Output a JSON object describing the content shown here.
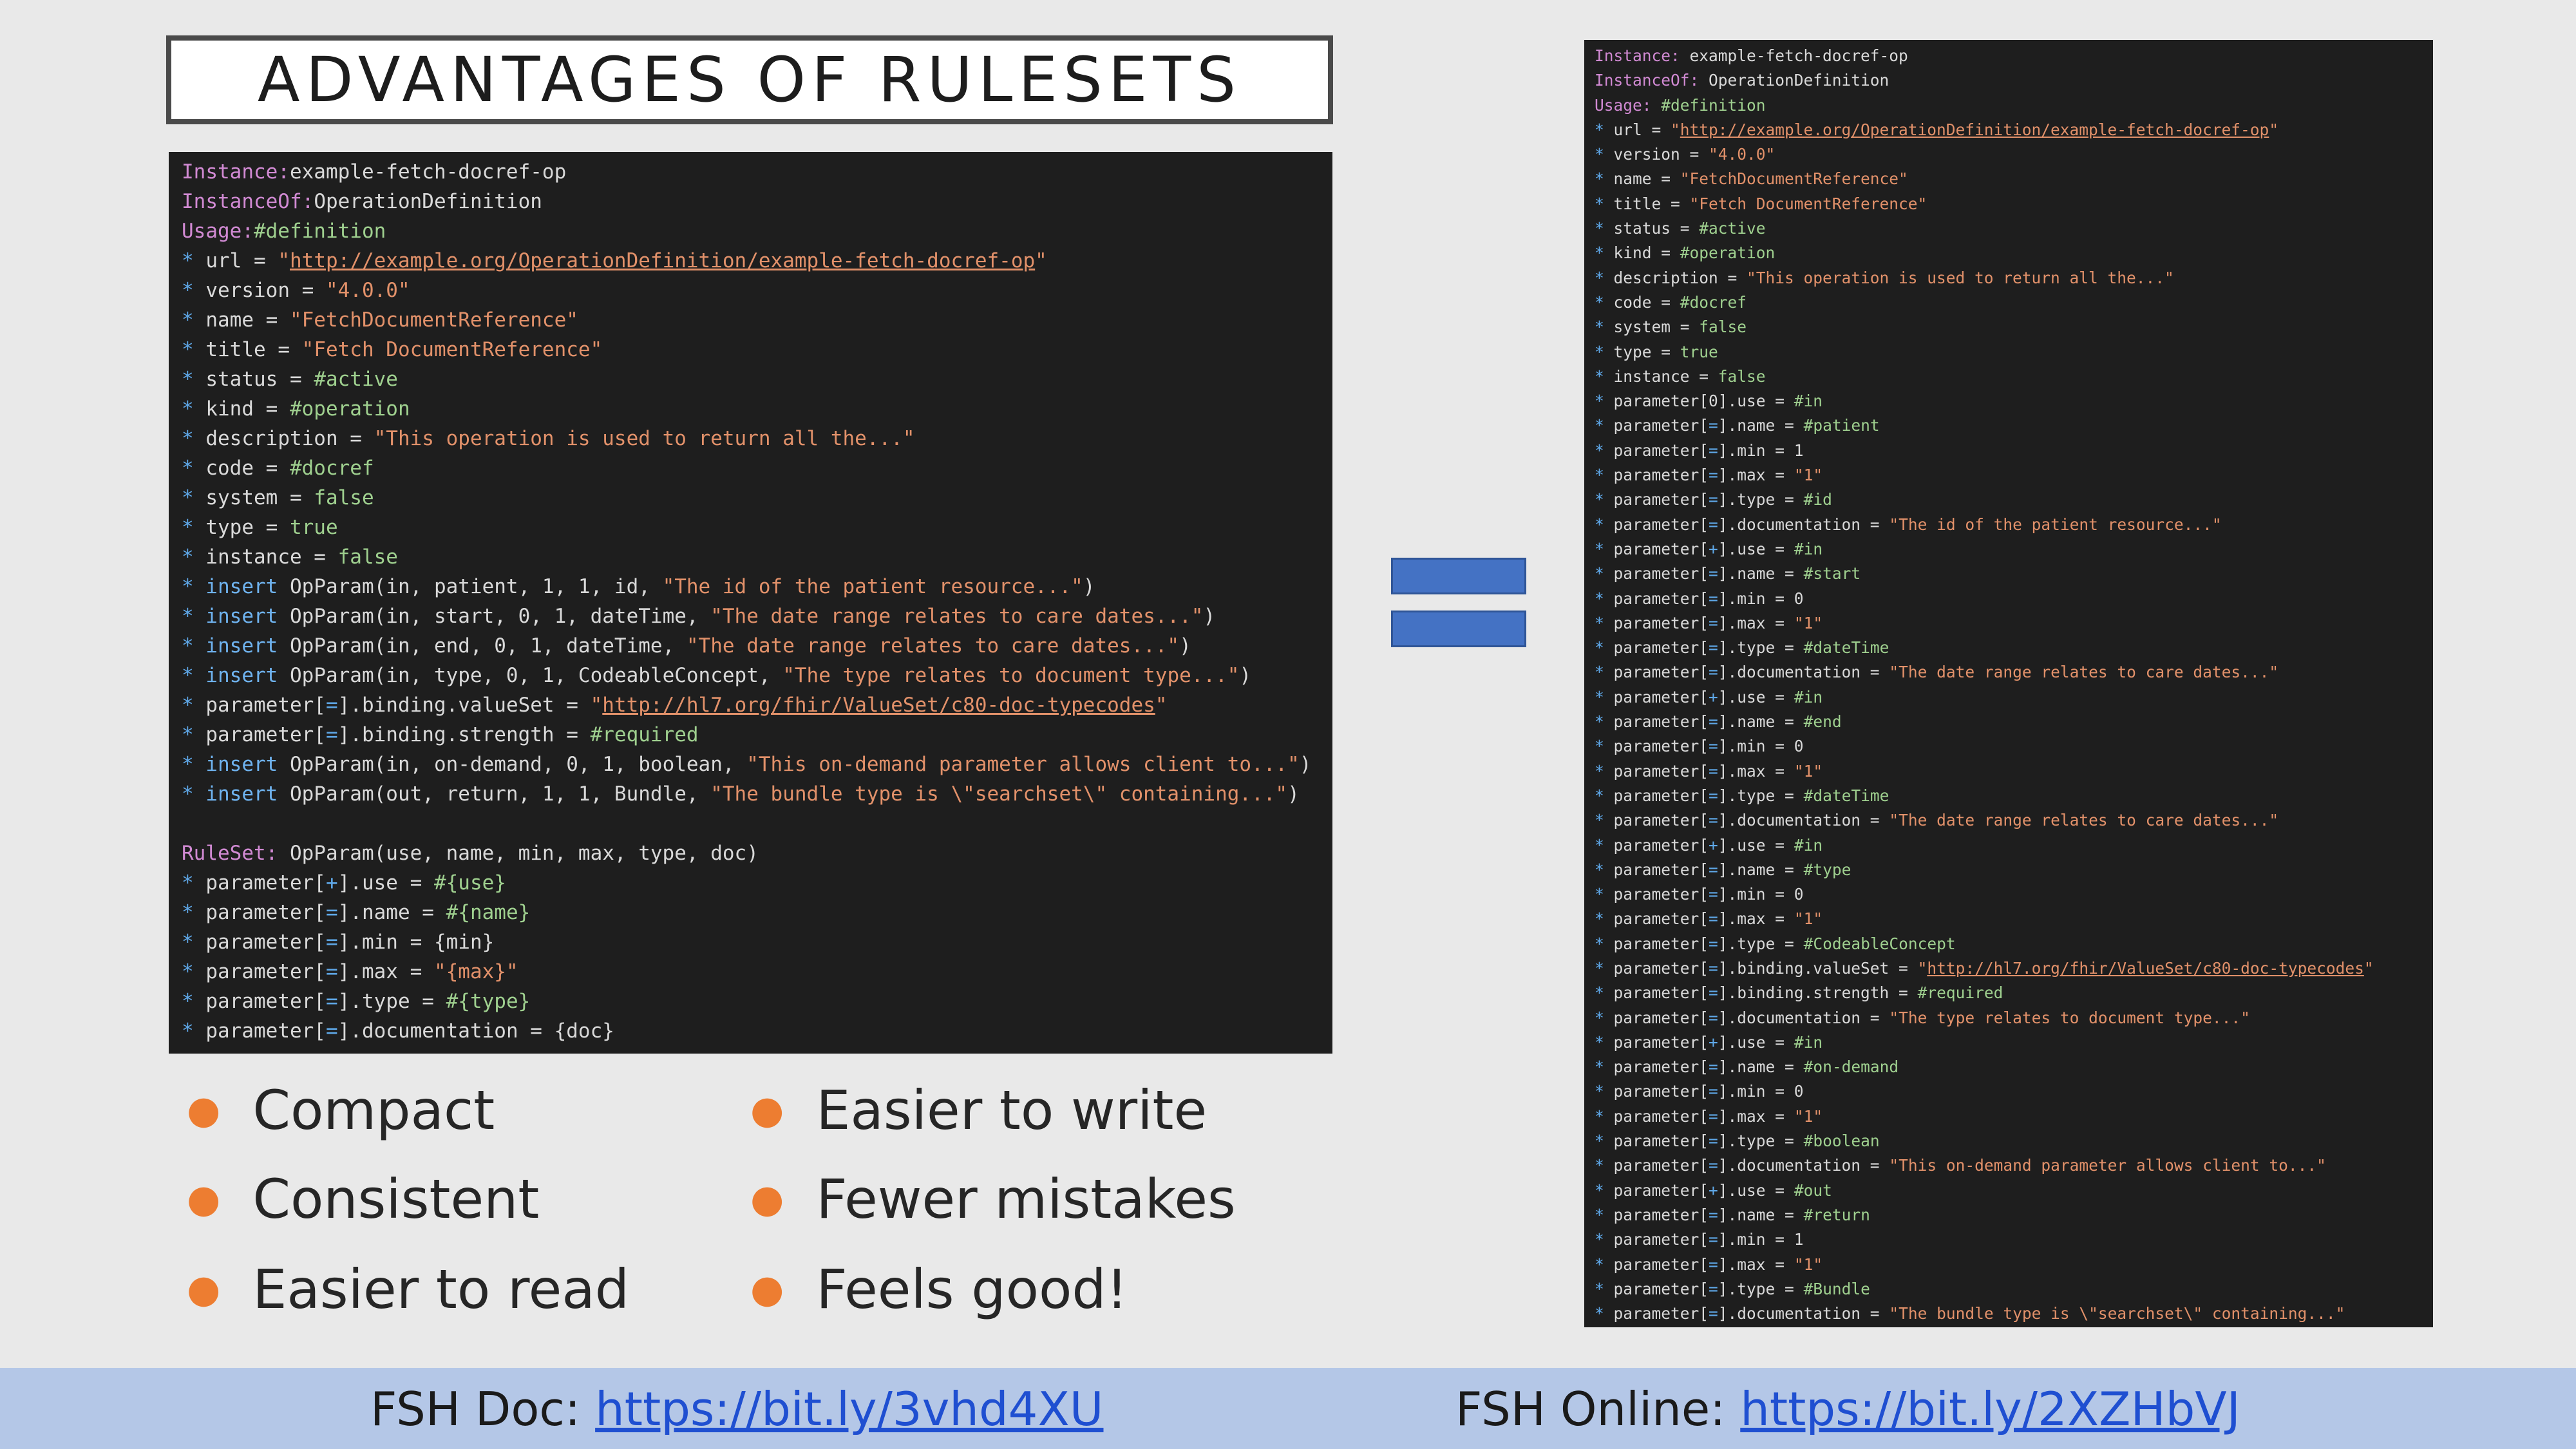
{
  "title": "ADVANTAGES OF RULESETS",
  "code_left": [
    [
      [
        "kw",
        "Instance:"
      ],
      [
        "",
        "example-fetch-docref-op"
      ]
    ],
    [
      [
        "kw",
        "InstanceOf:"
      ],
      [
        "",
        "OperationDefinition"
      ]
    ],
    [
      [
        "kw",
        "Usage:"
      ],
      [
        "lit",
        "#definition"
      ]
    ],
    [
      [
        "star",
        "*"
      ],
      [
        "",
        " url = "
      ],
      [
        "str",
        "\""
      ],
      [
        "str url",
        "http://example.org/OperationDefinition/example-fetch-docref-op"
      ],
      [
        "str",
        "\""
      ]
    ],
    [
      [
        "star",
        "*"
      ],
      [
        "",
        " version = "
      ],
      [
        "str",
        "\"4.0.0\""
      ]
    ],
    [
      [
        "star",
        "*"
      ],
      [
        "",
        " name = "
      ],
      [
        "str",
        "\"FetchDocumentReference\""
      ]
    ],
    [
      [
        "star",
        "*"
      ],
      [
        "",
        " title = "
      ],
      [
        "str",
        "\"Fetch DocumentReference\""
      ]
    ],
    [
      [
        "star",
        "*"
      ],
      [
        "",
        " status = "
      ],
      [
        "lit",
        "#active"
      ]
    ],
    [
      [
        "star",
        "*"
      ],
      [
        "",
        " kind = "
      ],
      [
        "lit",
        "#operation"
      ]
    ],
    [
      [
        "star",
        "*"
      ],
      [
        "",
        " description = "
      ],
      [
        "str",
        "\"This operation is used to return all the...\""
      ]
    ],
    [
      [
        "star",
        "*"
      ],
      [
        "",
        " code = "
      ],
      [
        "lit",
        "#docref"
      ]
    ],
    [
      [
        "star",
        "*"
      ],
      [
        "",
        " system = "
      ],
      [
        "lit",
        "false"
      ]
    ],
    [
      [
        "star",
        "*"
      ],
      [
        "",
        " type = "
      ],
      [
        "lit",
        "true"
      ]
    ],
    [
      [
        "star",
        "*"
      ],
      [
        "",
        " instance = "
      ],
      [
        "lit",
        "false"
      ]
    ],
    [
      [
        "star",
        "*"
      ],
      [
        "ins",
        " insert"
      ],
      [
        "",
        " OpParam(in, patient, 1, 1, id, "
      ],
      [
        "str",
        "\"The id of the patient resource...\""
      ],
      [
        "",
        ")"
      ]
    ],
    [
      [
        "star",
        "*"
      ],
      [
        "ins",
        " insert"
      ],
      [
        "",
        " OpParam(in, start, 0, 1, dateTime, "
      ],
      [
        "str",
        "\"The date range relates to care dates...\""
      ],
      [
        "",
        ")"
      ]
    ],
    [
      [
        "star",
        "*"
      ],
      [
        "ins",
        " insert"
      ],
      [
        "",
        " OpParam(in, end, 0, 1, dateTime, "
      ],
      [
        "str",
        "\"The date range relates to care dates...\""
      ],
      [
        "",
        ")"
      ]
    ],
    [
      [
        "star",
        "*"
      ],
      [
        "ins",
        " insert"
      ],
      [
        "",
        " OpParam(in, type, 0, 1, CodeableConcept, "
      ],
      [
        "str",
        "\"The type relates to document type...\""
      ],
      [
        "",
        ")"
      ]
    ],
    [
      [
        "star",
        "*"
      ],
      [
        "",
        " parameter["
      ],
      [
        "star",
        "="
      ],
      [
        "",
        "].binding.valueSet = "
      ],
      [
        "str",
        "\""
      ],
      [
        "str url",
        "http://hl7.org/fhir/ValueSet/c80-doc-typecodes"
      ],
      [
        "str",
        "\""
      ]
    ],
    [
      [
        "star",
        "*"
      ],
      [
        "",
        " parameter["
      ],
      [
        "star",
        "="
      ],
      [
        "",
        "].binding.strength = "
      ],
      [
        "lit",
        "#required"
      ]
    ],
    [
      [
        "star",
        "*"
      ],
      [
        "ins",
        " insert"
      ],
      [
        "",
        " OpParam(in, on-demand, 0, 1, boolean, "
      ],
      [
        "str",
        "\"This on-demand parameter allows client to...\""
      ],
      [
        "",
        ")"
      ]
    ],
    [
      [
        "star",
        "*"
      ],
      [
        "ins",
        " insert"
      ],
      [
        "",
        " OpParam(out, return, 1, 1, Bundle, "
      ],
      [
        "str",
        "\"The bundle type is \\\"searchset\\\" containing...\""
      ],
      [
        "",
        ")"
      ]
    ],
    [
      [
        "",
        ""
      ]
    ],
    [
      [
        "kw",
        "RuleSet:"
      ],
      [
        "",
        " OpParam(use, name, min, max, type, doc)"
      ]
    ],
    [
      [
        "star",
        "*"
      ],
      [
        "",
        " parameter["
      ],
      [
        "star",
        "+"
      ],
      [
        "",
        "].use = "
      ],
      [
        "lit",
        "#{use}"
      ]
    ],
    [
      [
        "star",
        "*"
      ],
      [
        "",
        " parameter["
      ],
      [
        "star",
        "="
      ],
      [
        "",
        "].name = "
      ],
      [
        "lit",
        "#{name}"
      ]
    ],
    [
      [
        "star",
        "*"
      ],
      [
        "",
        " parameter["
      ],
      [
        "star",
        "="
      ],
      [
        "",
        "].min = {min}"
      ]
    ],
    [
      [
        "star",
        "*"
      ],
      [
        "",
        " parameter["
      ],
      [
        "star",
        "="
      ],
      [
        "",
        "].max = "
      ],
      [
        "str",
        "\"{max}\""
      ]
    ],
    [
      [
        "star",
        "*"
      ],
      [
        "",
        " parameter["
      ],
      [
        "star",
        "="
      ],
      [
        "",
        "].type = "
      ],
      [
        "lit",
        "#{type}"
      ]
    ],
    [
      [
        "star",
        "*"
      ],
      [
        "",
        " parameter["
      ],
      [
        "star",
        "="
      ],
      [
        "",
        "].documentation = {doc}"
      ]
    ]
  ],
  "code_right": [
    [
      [
        "kw",
        "Instance:"
      ],
      [
        "",
        " example-fetch-docref-op"
      ]
    ],
    [
      [
        "kw",
        "InstanceOf:"
      ],
      [
        "",
        " OperationDefinition"
      ]
    ],
    [
      [
        "kw",
        "Usage:"
      ],
      [
        "lit",
        " #definition"
      ]
    ],
    [
      [
        "star",
        "*"
      ],
      [
        "",
        " url = "
      ],
      [
        "str",
        "\""
      ],
      [
        "str url",
        "http://example.org/OperationDefinition/example-fetch-docref-op"
      ],
      [
        "str",
        "\""
      ]
    ],
    [
      [
        "star",
        "*"
      ],
      [
        "",
        " version = "
      ],
      [
        "str",
        "\"4.0.0\""
      ]
    ],
    [
      [
        "star",
        "*"
      ],
      [
        "",
        " name = "
      ],
      [
        "str",
        "\"FetchDocumentReference\""
      ]
    ],
    [
      [
        "star",
        "*"
      ],
      [
        "",
        " title = "
      ],
      [
        "str",
        "\"Fetch DocumentReference\""
      ]
    ],
    [
      [
        "star",
        "*"
      ],
      [
        "",
        " status = "
      ],
      [
        "lit",
        "#active"
      ]
    ],
    [
      [
        "star",
        "*"
      ],
      [
        "",
        " kind = "
      ],
      [
        "lit",
        "#operation"
      ]
    ],
    [
      [
        "star",
        "*"
      ],
      [
        "",
        " description = "
      ],
      [
        "str",
        "\"This operation is used to return all the...\""
      ]
    ],
    [
      [
        "star",
        "*"
      ],
      [
        "",
        " code = "
      ],
      [
        "lit",
        "#docref"
      ]
    ],
    [
      [
        "star",
        "*"
      ],
      [
        "",
        " system = "
      ],
      [
        "lit",
        "false"
      ]
    ],
    [
      [
        "star",
        "*"
      ],
      [
        "",
        " type = "
      ],
      [
        "lit",
        "true"
      ]
    ],
    [
      [
        "star",
        "*"
      ],
      [
        "",
        " instance = "
      ],
      [
        "lit",
        "false"
      ]
    ],
    [
      [
        "star",
        "*"
      ],
      [
        "",
        " parameter[0].use = "
      ],
      [
        "lit",
        "#in"
      ]
    ],
    [
      [
        "star",
        "*"
      ],
      [
        "",
        " parameter["
      ],
      [
        "star",
        "="
      ],
      [
        "",
        "].name = "
      ],
      [
        "lit",
        "#patient"
      ]
    ],
    [
      [
        "star",
        "*"
      ],
      [
        "",
        " parameter["
      ],
      [
        "star",
        "="
      ],
      [
        "",
        "].min = 1"
      ]
    ],
    [
      [
        "star",
        "*"
      ],
      [
        "",
        " parameter["
      ],
      [
        "star",
        "="
      ],
      [
        "",
        "].max = "
      ],
      [
        "str",
        "\"1\""
      ]
    ],
    [
      [
        "star",
        "*"
      ],
      [
        "",
        " parameter["
      ],
      [
        "star",
        "="
      ],
      [
        "",
        "].type = "
      ],
      [
        "lit",
        "#id"
      ]
    ],
    [
      [
        "star",
        "*"
      ],
      [
        "",
        " parameter["
      ],
      [
        "star",
        "="
      ],
      [
        "",
        "].documentation = "
      ],
      [
        "str",
        "\"The id of the patient resource...\""
      ]
    ],
    [
      [
        "star",
        "*"
      ],
      [
        "",
        " parameter["
      ],
      [
        "star",
        "+"
      ],
      [
        "",
        "].use = "
      ],
      [
        "lit",
        "#in"
      ]
    ],
    [
      [
        "star",
        "*"
      ],
      [
        "",
        " parameter["
      ],
      [
        "star",
        "="
      ],
      [
        "",
        "].name = "
      ],
      [
        "lit",
        "#start"
      ]
    ],
    [
      [
        "star",
        "*"
      ],
      [
        "",
        " parameter["
      ],
      [
        "star",
        "="
      ],
      [
        "",
        "].min = 0"
      ]
    ],
    [
      [
        "star",
        "*"
      ],
      [
        "",
        " parameter["
      ],
      [
        "star",
        "="
      ],
      [
        "",
        "].max = "
      ],
      [
        "str",
        "\"1\""
      ]
    ],
    [
      [
        "star",
        "*"
      ],
      [
        "",
        " parameter["
      ],
      [
        "star",
        "="
      ],
      [
        "",
        "].type = "
      ],
      [
        "lit",
        "#dateTime"
      ]
    ],
    [
      [
        "star",
        "*"
      ],
      [
        "",
        " parameter["
      ],
      [
        "star",
        "="
      ],
      [
        "",
        "].documentation = "
      ],
      [
        "str",
        "\"The date range relates to care dates...\""
      ]
    ],
    [
      [
        "star",
        "*"
      ],
      [
        "",
        " parameter["
      ],
      [
        "star",
        "+"
      ],
      [
        "",
        "].use = "
      ],
      [
        "lit",
        "#in"
      ]
    ],
    [
      [
        "star",
        "*"
      ],
      [
        "",
        " parameter["
      ],
      [
        "star",
        "="
      ],
      [
        "",
        "].name = "
      ],
      [
        "lit",
        "#end"
      ]
    ],
    [
      [
        "star",
        "*"
      ],
      [
        "",
        " parameter["
      ],
      [
        "star",
        "="
      ],
      [
        "",
        "].min = 0"
      ]
    ],
    [
      [
        "star",
        "*"
      ],
      [
        "",
        " parameter["
      ],
      [
        "star",
        "="
      ],
      [
        "",
        "].max = "
      ],
      [
        "str",
        "\"1\""
      ]
    ],
    [
      [
        "star",
        "*"
      ],
      [
        "",
        " parameter["
      ],
      [
        "star",
        "="
      ],
      [
        "",
        "].type = "
      ],
      [
        "lit",
        "#dateTime"
      ]
    ],
    [
      [
        "star",
        "*"
      ],
      [
        "",
        " parameter["
      ],
      [
        "star",
        "="
      ],
      [
        "",
        "].documentation = "
      ],
      [
        "str",
        "\"The date range relates to care dates...\""
      ]
    ],
    [
      [
        "star",
        "*"
      ],
      [
        "",
        " parameter["
      ],
      [
        "star",
        "+"
      ],
      [
        "",
        "].use = "
      ],
      [
        "lit",
        "#in"
      ]
    ],
    [
      [
        "star",
        "*"
      ],
      [
        "",
        " parameter["
      ],
      [
        "star",
        "="
      ],
      [
        "",
        "].name = "
      ],
      [
        "lit",
        "#type"
      ]
    ],
    [
      [
        "star",
        "*"
      ],
      [
        "",
        " parameter["
      ],
      [
        "star",
        "="
      ],
      [
        "",
        "].min = 0"
      ]
    ],
    [
      [
        "star",
        "*"
      ],
      [
        "",
        " parameter["
      ],
      [
        "star",
        "="
      ],
      [
        "",
        "].max = "
      ],
      [
        "str",
        "\"1\""
      ]
    ],
    [
      [
        "star",
        "*"
      ],
      [
        "",
        " parameter["
      ],
      [
        "star",
        "="
      ],
      [
        "",
        "].type = "
      ],
      [
        "lit",
        "#CodeableConcept"
      ]
    ],
    [
      [
        "star",
        "*"
      ],
      [
        "",
        " parameter["
      ],
      [
        "star",
        "="
      ],
      [
        "",
        "].binding.valueSet = "
      ],
      [
        "str",
        "\""
      ],
      [
        "str url",
        "http://hl7.org/fhir/ValueSet/c80-doc-typecodes"
      ],
      [
        "str",
        "\""
      ]
    ],
    [
      [
        "star",
        "*"
      ],
      [
        "",
        " parameter["
      ],
      [
        "star",
        "="
      ],
      [
        "",
        "].binding.strength = "
      ],
      [
        "lit",
        "#required"
      ]
    ],
    [
      [
        "star",
        "*"
      ],
      [
        "",
        " parameter["
      ],
      [
        "star",
        "="
      ],
      [
        "",
        "].documentation = "
      ],
      [
        "str",
        "\"The type relates to document type...\""
      ]
    ],
    [
      [
        "star",
        "*"
      ],
      [
        "",
        " parameter["
      ],
      [
        "star",
        "+"
      ],
      [
        "",
        "].use = "
      ],
      [
        "lit",
        "#in"
      ]
    ],
    [
      [
        "star",
        "*"
      ],
      [
        "",
        " parameter["
      ],
      [
        "star",
        "="
      ],
      [
        "",
        "].name = "
      ],
      [
        "lit",
        "#on-demand"
      ]
    ],
    [
      [
        "star",
        "*"
      ],
      [
        "",
        " parameter["
      ],
      [
        "star",
        "="
      ],
      [
        "",
        "].min = 0"
      ]
    ],
    [
      [
        "star",
        "*"
      ],
      [
        "",
        " parameter["
      ],
      [
        "star",
        "="
      ],
      [
        "",
        "].max = "
      ],
      [
        "str",
        "\"1\""
      ]
    ],
    [
      [
        "star",
        "*"
      ],
      [
        "",
        " parameter["
      ],
      [
        "star",
        "="
      ],
      [
        "",
        "].type = "
      ],
      [
        "lit",
        "#boolean"
      ]
    ],
    [
      [
        "star",
        "*"
      ],
      [
        "",
        " parameter["
      ],
      [
        "star",
        "="
      ],
      [
        "",
        "].documentation = "
      ],
      [
        "str",
        "\"This on-demand parameter allows client to...\""
      ]
    ],
    [
      [
        "star",
        "*"
      ],
      [
        "",
        " parameter["
      ],
      [
        "star",
        "+"
      ],
      [
        "",
        "].use = "
      ],
      [
        "lit",
        "#out"
      ]
    ],
    [
      [
        "star",
        "*"
      ],
      [
        "",
        " parameter["
      ],
      [
        "star",
        "="
      ],
      [
        "",
        "].name = "
      ],
      [
        "lit",
        "#return"
      ]
    ],
    [
      [
        "star",
        "*"
      ],
      [
        "",
        " parameter["
      ],
      [
        "star",
        "="
      ],
      [
        "",
        "].min = 1"
      ]
    ],
    [
      [
        "star",
        "*"
      ],
      [
        "",
        " parameter["
      ],
      [
        "star",
        "="
      ],
      [
        "",
        "].max = "
      ],
      [
        "str",
        "\"1\""
      ]
    ],
    [
      [
        "star",
        "*"
      ],
      [
        "",
        " parameter["
      ],
      [
        "star",
        "="
      ],
      [
        "",
        "].type = "
      ],
      [
        "lit",
        "#Bundle"
      ]
    ],
    [
      [
        "star",
        "*"
      ],
      [
        "",
        " parameter["
      ],
      [
        "star",
        "="
      ],
      [
        "",
        "].documentation = "
      ],
      [
        "str",
        "\"The bundle type is \\\"searchset\\\" containing...\""
      ]
    ]
  ],
  "bullets": {
    "left": [
      "Compact",
      "Consistent",
      "Easier to read"
    ],
    "right": [
      "Easier to write",
      "Fewer mistakes",
      "Feels good!"
    ]
  },
  "footer": {
    "doc_label": "FSH Doc: ",
    "doc_link": "https://bit.ly/3vhd4XU",
    "online_label": "FSH Online: ",
    "online_link": "https://bit.ly/2XZHbVJ"
  },
  "colors": {
    "accent_bullet": "#ed7d31",
    "equals_sign": "#4472c4",
    "footer_bg": "#b4c7e7"
  }
}
